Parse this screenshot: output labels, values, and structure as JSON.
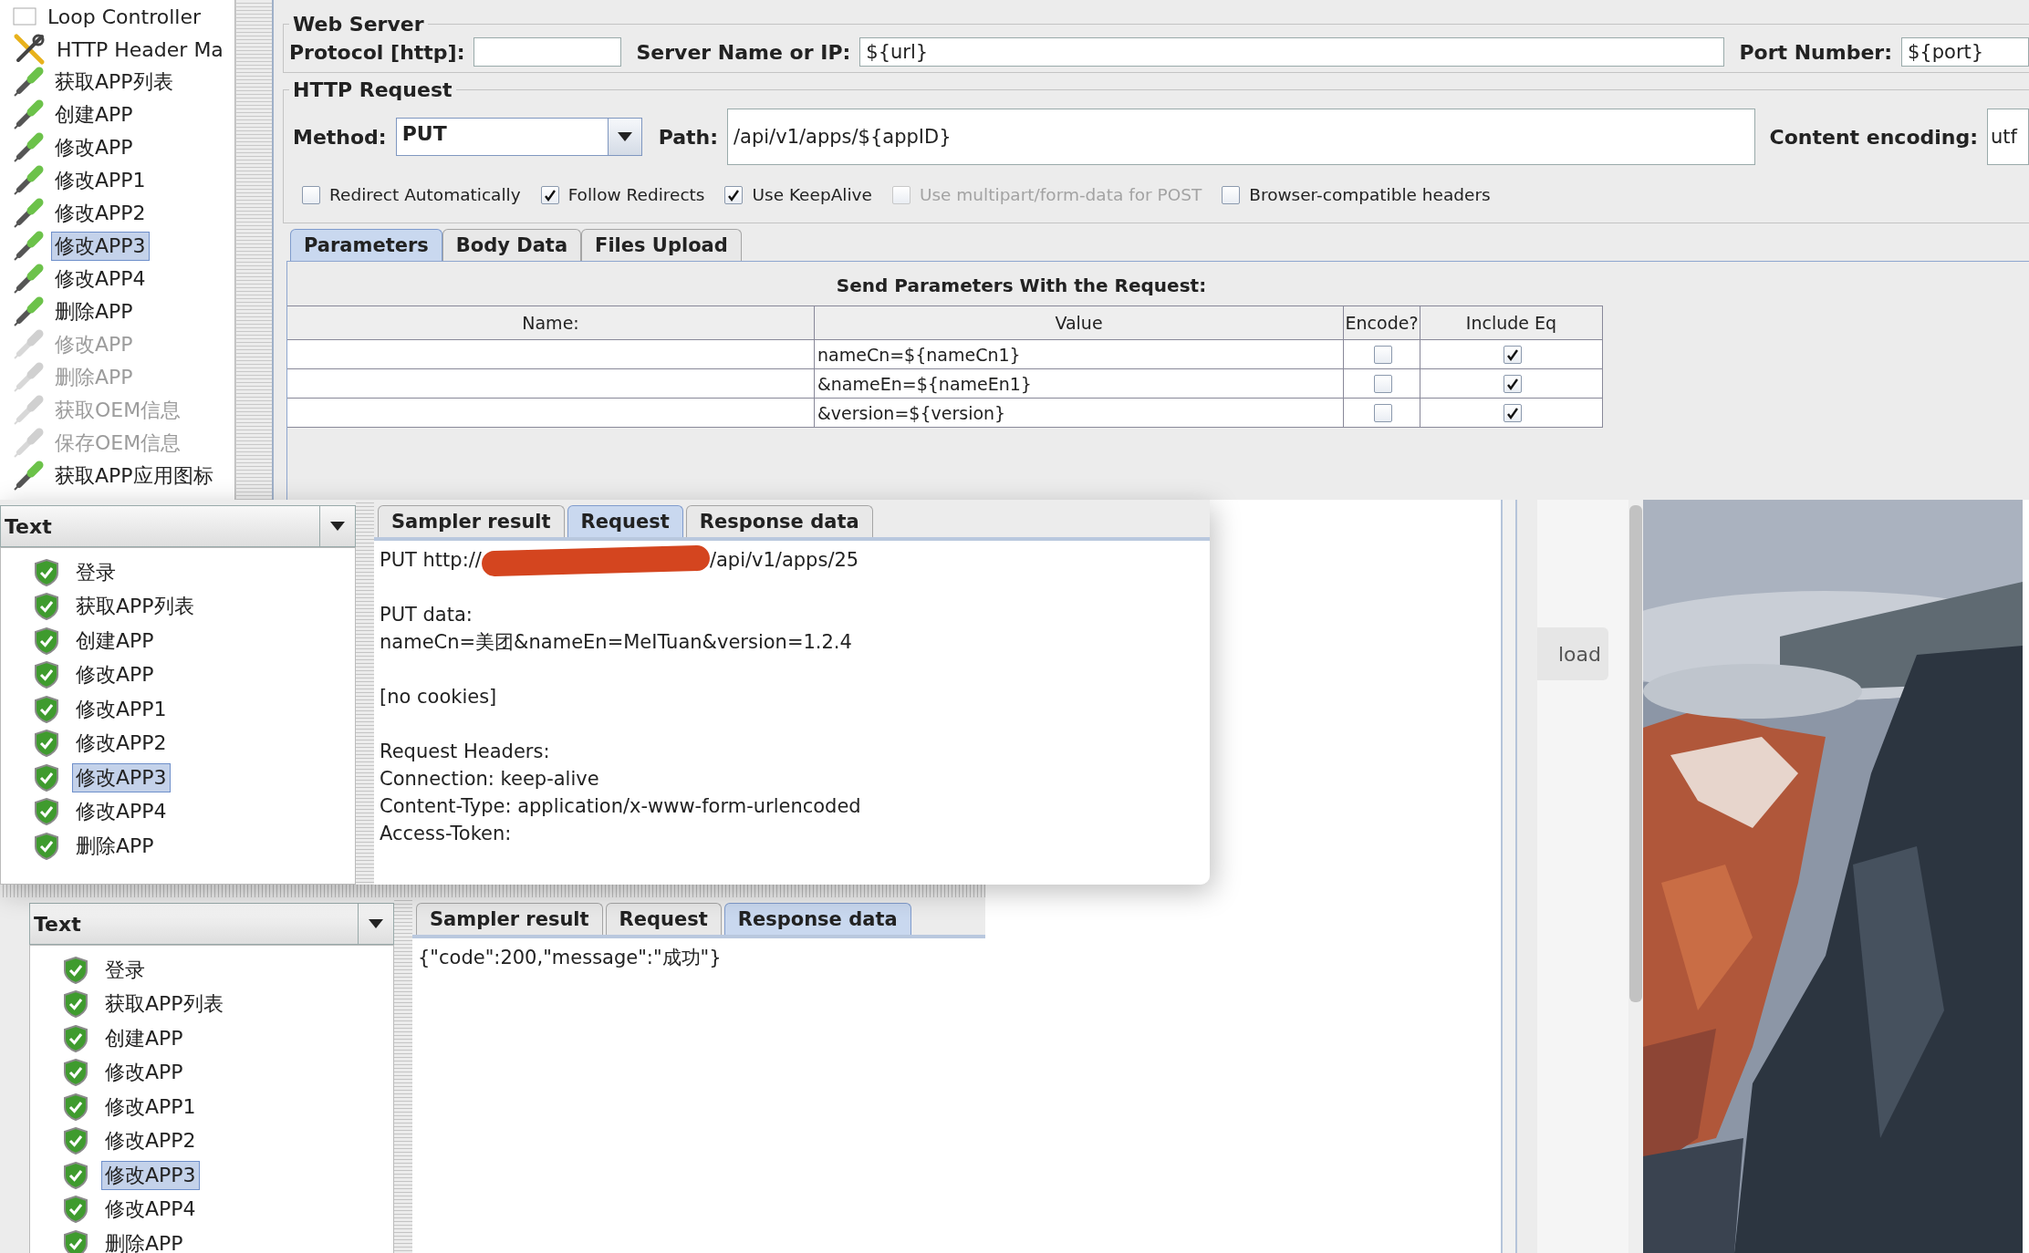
{
  "test_plan": {
    "items": [
      {
        "label": "Loop Controller",
        "kind": "controller",
        "selected": false,
        "disabled": false
      },
      {
        "label": "HTTP Header Ma",
        "kind": "config",
        "selected": false,
        "disabled": false
      },
      {
        "label": "获取APP列表",
        "kind": "sampler",
        "selected": false,
        "disabled": false
      },
      {
        "label": "创建APP",
        "kind": "sampler",
        "selected": false,
        "disabled": false
      },
      {
        "label": "修改APP",
        "kind": "sampler",
        "selected": false,
        "disabled": false
      },
      {
        "label": "修改APP1",
        "kind": "sampler",
        "selected": false,
        "disabled": false
      },
      {
        "label": "修改APP2",
        "kind": "sampler",
        "selected": false,
        "disabled": false
      },
      {
        "label": "修改APP3",
        "kind": "sampler",
        "selected": true,
        "disabled": false
      },
      {
        "label": "修改APP4",
        "kind": "sampler",
        "selected": false,
        "disabled": false
      },
      {
        "label": "删除APP",
        "kind": "sampler",
        "selected": false,
        "disabled": false
      },
      {
        "label": "修改APP",
        "kind": "sampler",
        "selected": false,
        "disabled": true
      },
      {
        "label": "删除APP",
        "kind": "sampler",
        "selected": false,
        "disabled": true
      },
      {
        "label": "获取OEM信息",
        "kind": "sampler",
        "selected": false,
        "disabled": true
      },
      {
        "label": "保存OEM信息",
        "kind": "sampler",
        "selected": false,
        "disabled": true
      },
      {
        "label": "获取APP应用图标",
        "kind": "sampler",
        "selected": false,
        "disabled": false
      }
    ]
  },
  "web_server": {
    "title": "Web Server",
    "protocol_label": "Protocol [http]:",
    "server_label": "Server Name or IP:",
    "server_value": "${url}",
    "port_label": "Port Number:",
    "port_value": "${port}"
  },
  "http_request": {
    "title": "HTTP Request",
    "method_label": "Method:",
    "method": "PUT",
    "path_label": "Path:",
    "path": "/api/v1/apps/${appID}",
    "encoding_label": "Content encoding:",
    "encoding": "utf"
  },
  "options": [
    {
      "label": "Redirect Automatically",
      "checked": false,
      "disabled": false
    },
    {
      "label": "Follow Redirects",
      "checked": true,
      "disabled": false
    },
    {
      "label": "Use KeepAlive",
      "checked": true,
      "disabled": false
    },
    {
      "label": "Use multipart/form-data for POST",
      "checked": false,
      "disabled": true
    },
    {
      "label": "Browser-compatible headers",
      "checked": false,
      "disabled": false
    }
  ],
  "request_tabs": [
    {
      "label": "Parameters",
      "selected": true
    },
    {
      "label": "Body Data",
      "selected": false
    },
    {
      "label": "Files Upload",
      "selected": false
    }
  ],
  "parameters": {
    "title": "Send Parameters With the Request:",
    "columns": [
      "Name:",
      "Value",
      "Encode?",
      "Include Eq"
    ],
    "rows": [
      {
        "value": "nameCn=${nameCn1}",
        "encode": false,
        "include_equals": true
      },
      {
        "value": "&nameEn=${nameEn1}",
        "encode": false,
        "include_equals": true
      },
      {
        "value": "&version=${version}",
        "encode": false,
        "include_equals": true
      }
    ]
  },
  "result_windows": [
    {
      "tree_header": "Text",
      "items": [
        {
          "label": "登录",
          "selected": false
        },
        {
          "label": "获取APP列表",
          "selected": false
        },
        {
          "label": "创建APP",
          "selected": false
        },
        {
          "label": "修改APP",
          "selected": false
        },
        {
          "label": "修改APP1",
          "selected": false
        },
        {
          "label": "修改APP2",
          "selected": false
        },
        {
          "label": "修改APP3",
          "selected": true
        },
        {
          "label": "修改APP4",
          "selected": false
        },
        {
          "label": "删除APP",
          "selected": false
        }
      ],
      "tabs": [
        {
          "label": "Sampler result",
          "selected": false
        },
        {
          "label": "Request",
          "selected": true
        },
        {
          "label": "Response data",
          "selected": false
        }
      ],
      "content": [
        {
          "kind": "url",
          "before": "PUT http://",
          "after": "/api/v1/apps/25"
        },
        {
          "kind": "blank"
        },
        {
          "kind": "text",
          "text": "PUT data:"
        },
        {
          "kind": "text",
          "text": "nameCn=美团&nameEn=MeITuan&version=1.2.4"
        },
        {
          "kind": "blank"
        },
        {
          "kind": "text",
          "text": "[no cookies]"
        },
        {
          "kind": "blank"
        },
        {
          "kind": "text",
          "text": "Request Headers:"
        },
        {
          "kind": "text",
          "text": "Connection: keep-alive"
        },
        {
          "kind": "text",
          "text": "Content-Type: application/x-www-form-urlencoded"
        },
        {
          "kind": "text",
          "text": "Access-Token:"
        }
      ]
    },
    {
      "tree_header": "Text",
      "items": [
        {
          "label": "登录",
          "selected": false
        },
        {
          "label": "获取APP列表",
          "selected": false
        },
        {
          "label": "创建APP",
          "selected": false
        },
        {
          "label": "修改APP",
          "selected": false
        },
        {
          "label": "修改APP1",
          "selected": false
        },
        {
          "label": "修改APP2",
          "selected": false
        },
        {
          "label": "修改APP3",
          "selected": true
        },
        {
          "label": "修改APP4",
          "selected": false
        },
        {
          "label": "删除APP",
          "selected": false
        }
      ],
      "tabs": [
        {
          "label": "Sampler result",
          "selected": false
        },
        {
          "label": "Request",
          "selected": false
        },
        {
          "label": "Response data",
          "selected": true
        }
      ],
      "content": [
        {
          "kind": "text",
          "text": "{\"code\":200,\"message\":\"成功\"}"
        }
      ]
    }
  ],
  "browser_panel": {
    "button": "load"
  }
}
